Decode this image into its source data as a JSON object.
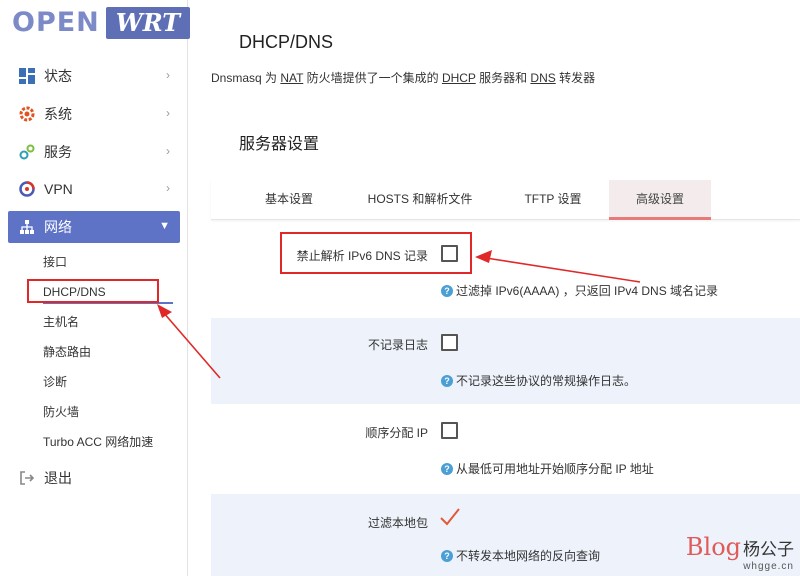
{
  "logo": {
    "open": "OPEN",
    "wrt": "WRT"
  },
  "sidebar": {
    "items": [
      {
        "label": "状态",
        "icon": "status-grid-icon"
      },
      {
        "label": "系统",
        "icon": "system-gear-icon"
      },
      {
        "label": "服务",
        "icon": "services-gears-icon"
      },
      {
        "label": "VPN",
        "icon": "vpn-icon"
      },
      {
        "label": "网络",
        "icon": "network-icon"
      }
    ],
    "subitems": [
      "接口",
      "DHCP/DNS",
      "主机名",
      "静态路由",
      "诊断",
      "防火墙",
      "Turbo ACC 网络加速"
    ],
    "logout": "退出"
  },
  "main": {
    "title": "DHCP/DNS",
    "desc": {
      "part1": "Dnsmasq 为 ",
      "nat": "NAT",
      "part2": " 防火墙提供了一个集成的 ",
      "dhcp": "DHCP",
      "part3": " 服务器和 ",
      "dns": "DNS",
      "part4": " 转发器"
    },
    "section": "服务器设置",
    "tabs": [
      "基本设置",
      "HOSTS 和解析文件",
      "TFTP 设置",
      "高级设置"
    ],
    "options": [
      {
        "label": "禁止解析 IPv6 DNS 记录",
        "hint": "过滤掉 IPv6(AAAA) ，只返回 IPv4 DNS 域名记录",
        "checked": false
      },
      {
        "label": "不记录日志",
        "hint": "不记录这些协议的常规操作日志。",
        "checked": false
      },
      {
        "label": "顺序分配 IP",
        "hint": "从最低可用地址开始顺序分配 IP 地址",
        "checked": false
      },
      {
        "label": "过滤本地包",
        "hint": "不转发本地网络的反向查询",
        "checked": true
      }
    ]
  },
  "watermark": {
    "blog": "Blog",
    "name": "杨公子",
    "site": "whgge.cn"
  },
  "colors": {
    "accent": "#5e72c6",
    "annotation": "#e02828",
    "active_tab": "#e87a7a"
  }
}
